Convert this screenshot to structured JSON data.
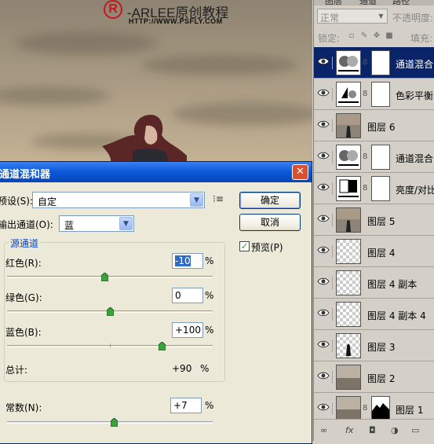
{
  "watermark": {
    "logo_mark": "R",
    "brand": "-ARLEE原创教程",
    "url": "HTTP://WWW.PSFLY.COM"
  },
  "dialog": {
    "title": "通道混和器",
    "preset_label": "预设(S):",
    "preset_value": "自定",
    "output_label": "输出通道(O):",
    "output_value": "蓝",
    "ok": "确定",
    "cancel": "取消",
    "preview_label": "预览(P)",
    "preview_checked": true,
    "source_group": "源通道",
    "channels": [
      {
        "label": "红色(R):",
        "value": "-10",
        "unit": "%",
        "slider": -10
      },
      {
        "label": "绿色(G):",
        "value": "0",
        "unit": "%",
        "slider": 0
      },
      {
        "label": "蓝色(B):",
        "value": "+100",
        "unit": "%",
        "slider": 100
      }
    ],
    "total_label": "总计:",
    "total_value": "+90",
    "total_unit": "%",
    "constant_label": "常数(N):",
    "constant_value": "+7",
    "constant_unit": "%",
    "constant_slider": 7
  },
  "layers_panel": {
    "tabs": [
      "图层",
      "通道",
      "路径"
    ],
    "blend_mode": "正常",
    "opacity_label": "不透明度:",
    "lock_label": "锁定:",
    "fill_label": "填充:",
    "layers": [
      {
        "name": "通道混合",
        "thumb": "adjustment-mixer",
        "mask": true,
        "selected": true
      },
      {
        "name": "色彩平衡",
        "thumb": "adjustment-balance",
        "mask": true,
        "selected": false
      },
      {
        "name": "图层 6",
        "thumb": "photo-figure",
        "mask": false,
        "selected": false
      },
      {
        "name": "通道混合",
        "thumb": "adjustment-mixer",
        "mask": true,
        "selected": false
      },
      {
        "name": "亮度/对比",
        "thumb": "adjustment-brightness",
        "mask": true,
        "selected": false
      },
      {
        "name": "图层 5",
        "thumb": "photo-figure",
        "mask": false,
        "selected": false
      },
      {
        "name": "图层 4",
        "thumb": "transparent",
        "mask": false,
        "selected": false
      },
      {
        "name": "图层 4 副本",
        "thumb": "transparent",
        "mask": false,
        "selected": false
      },
      {
        "name": "图层 4 副本 4",
        "thumb": "transparent",
        "mask": false,
        "selected": false
      },
      {
        "name": "图层 3",
        "thumb": "transparent-figure",
        "mask": false,
        "selected": false
      },
      {
        "name": "图层 2",
        "thumb": "photo-sky",
        "mask": false,
        "selected": false
      },
      {
        "name": "图层 1",
        "thumb": "photo-sky",
        "mask": true,
        "selected": false
      }
    ]
  }
}
